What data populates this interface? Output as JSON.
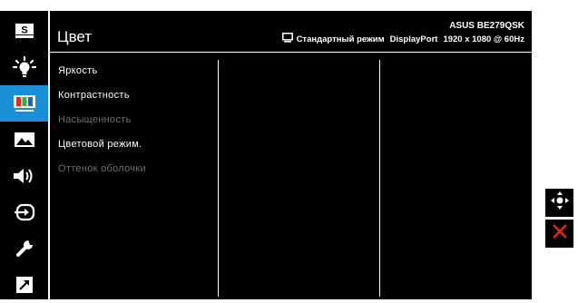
{
  "header": {
    "title": "Цвет",
    "model": "ASUS BE279QSK",
    "mode": "Стандартный режим",
    "input": "DisplayPort",
    "resolution": "1920 x 1080 @ 60Hz"
  },
  "sidebar": {
    "items": [
      {
        "icon": "splendid-s-icon",
        "active": false
      },
      {
        "icon": "blue-light-filter-icon",
        "active": false
      },
      {
        "icon": "color-icon",
        "active": true
      },
      {
        "icon": "image-icon",
        "active": false
      },
      {
        "icon": "sound-icon",
        "active": false
      },
      {
        "icon": "input-select-icon",
        "active": false
      },
      {
        "icon": "system-setup-icon",
        "active": false
      },
      {
        "icon": "shortcut-icon",
        "active": false
      }
    ]
  },
  "menu": {
    "items": [
      {
        "label": "Яркость",
        "enabled": true
      },
      {
        "label": "Контрастность",
        "enabled": true
      },
      {
        "label": "Насыщенность",
        "enabled": false
      },
      {
        "label": "Цветовой режим.",
        "enabled": true
      },
      {
        "label": "Оттенок оболочки",
        "enabled": false
      }
    ]
  },
  "controls": {
    "navigate_icon": "joystick-icon",
    "close_icon": "close-icon"
  },
  "colors": {
    "accent": "#1a8fd8",
    "text": "#ffffff",
    "disabled_text": "#6e6e6e",
    "close": "#e0251b"
  }
}
